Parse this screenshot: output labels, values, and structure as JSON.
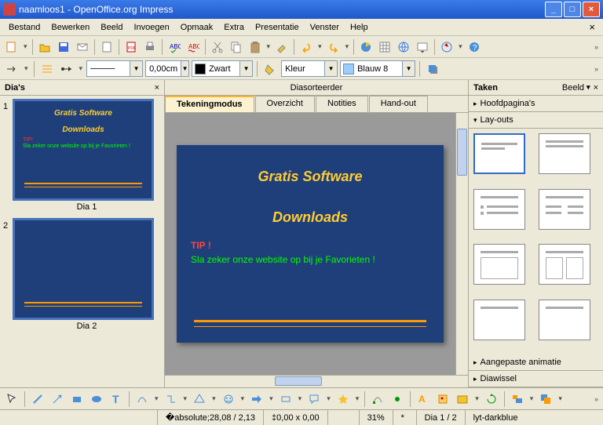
{
  "window": {
    "title": "naamloos1 - OpenOffice.org Impress"
  },
  "menu": [
    "Bestand",
    "Bewerken",
    "Beeld",
    "Invoegen",
    "Opmaak",
    "Extra",
    "Presentatie",
    "Venster",
    "Help"
  ],
  "toolbar2": {
    "line_style": "—",
    "line_width": "0,00cm",
    "line_color": "Zwart",
    "fill_mode": "Kleur",
    "fill_color": "Blauw 8"
  },
  "slides_panel": {
    "title": "Dia's",
    "items": [
      {
        "num": "1",
        "label": "Dia 1",
        "title1": "Gratis Software",
        "title2": "Downloads",
        "tip": "TIP!",
        "txt": "Sla zeker onze website op bij je Favorieten !"
      },
      {
        "num": "2",
        "label": "Dia 2"
      }
    ]
  },
  "center": {
    "view_toggle": "Diasorteerder",
    "tabs": [
      "Tekeningmodus",
      "Overzicht",
      "Notities",
      "Hand-out"
    ],
    "active_tab": 0,
    "slide": {
      "title1": "Gratis Software",
      "title2": "Downloads",
      "tip": "TIP !",
      "text": "Sla zeker onze website op bij je Favorieten !"
    }
  },
  "tasks": {
    "title": "Taken",
    "view_label": "Beeld",
    "sections": [
      "Hoofdpagina's",
      "Lay-outs",
      "Aangepaste animatie",
      "Diawissel"
    ],
    "open_section": 1
  },
  "status": {
    "pos": "28,08 / 2,13",
    "size": "0,00 x 0,00",
    "zoom": "31%",
    "slide": "Dia 1 / 2",
    "template": "lyt-darkblue"
  },
  "colors": {
    "black_swatch": "#000000",
    "blue8_swatch": "#99ccff"
  }
}
